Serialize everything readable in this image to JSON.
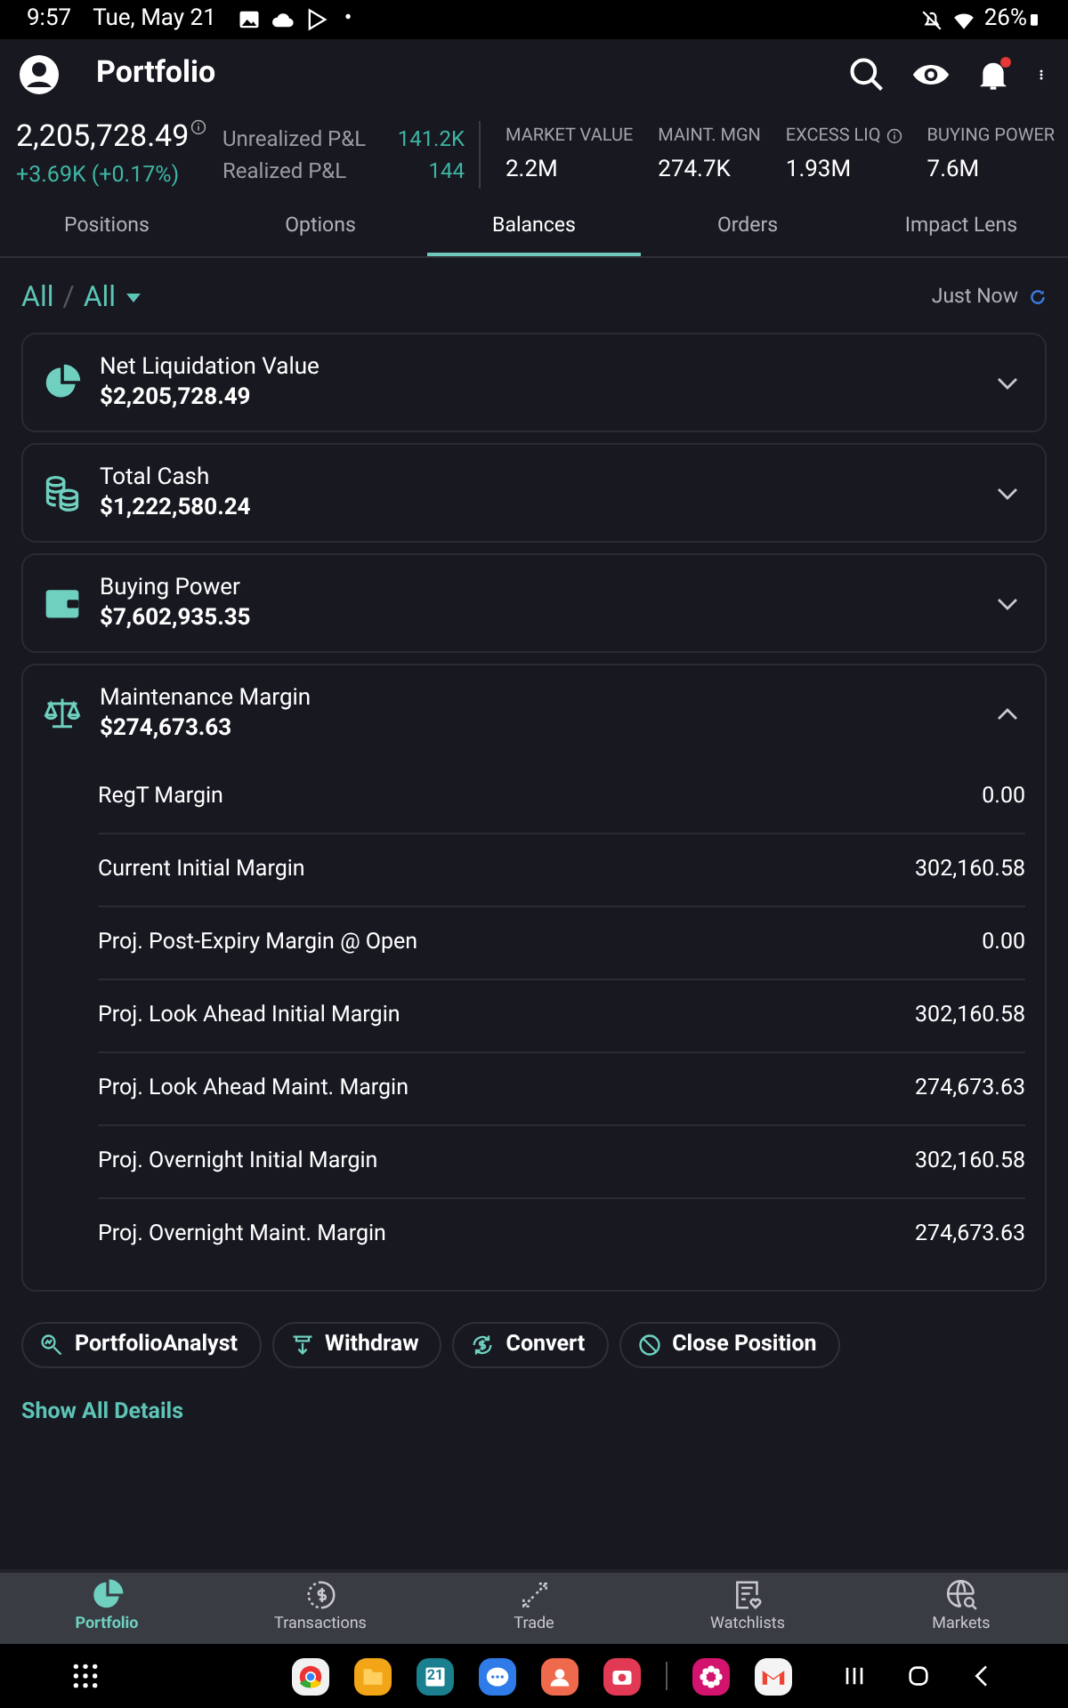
{
  "status_bar": {
    "time": "9:57",
    "date": "Tue, May 21",
    "dot": "•",
    "battery": "26%"
  },
  "header": {
    "title": "Portfolio",
    "notification_unread": true
  },
  "summary": {
    "net_value": "2,205,728.49",
    "change": "+3.69K (+0.17%)",
    "pnl": [
      {
        "label": "Unrealized P&L",
        "value": "141.2K"
      },
      {
        "label": "Realized P&L",
        "value": "144"
      }
    ],
    "metrics": [
      {
        "label": "MARKET VALUE",
        "value": "2.2M",
        "info": false
      },
      {
        "label": "MAINT. MGN",
        "value": "274.7K",
        "info": false
      },
      {
        "label": "EXCESS LIQ",
        "value": "1.93M",
        "info": true
      },
      {
        "label": "BUYING POWER",
        "value": "7.6M",
        "info": false
      }
    ]
  },
  "tabs": [
    {
      "label": "Positions",
      "selected": false
    },
    {
      "label": "Options",
      "selected": false
    },
    {
      "label": "Balances",
      "selected": true
    },
    {
      "label": "Orders",
      "selected": false
    },
    {
      "label": "Impact Lens",
      "selected": false
    }
  ],
  "filter": {
    "account": "All",
    "separator": "/",
    "group": "All",
    "updated": "Just Now"
  },
  "cards": [
    {
      "kind": "pie",
      "title": "Net Liquidation Value",
      "value": "$2,205,728.49",
      "expanded": false
    },
    {
      "kind": "coins",
      "title": "Total Cash",
      "value": "$1,222,580.24",
      "expanded": false
    },
    {
      "kind": "wallet",
      "title": "Buying Power",
      "value": "$7,602,935.35",
      "expanded": false
    },
    {
      "kind": "scale",
      "title": "Maintenance Margin",
      "value": "$274,673.63",
      "expanded": true,
      "rows": [
        {
          "label": "RegT Margin",
          "value": "0.00"
        },
        {
          "label": "Current Initial Margin",
          "value": "302,160.58"
        },
        {
          "label": "Proj. Post-Expiry Margin @ Open",
          "value": "0.00"
        },
        {
          "label": "Proj. Look Ahead Initial Margin",
          "value": "302,160.58"
        },
        {
          "label": "Proj. Look Ahead Maint. Margin",
          "value": "274,673.63"
        },
        {
          "label": "Proj. Overnight Initial Margin",
          "value": "302,160.58"
        },
        {
          "label": "Proj. Overnight Maint. Margin",
          "value": "274,673.63"
        }
      ]
    }
  ],
  "actions": [
    {
      "kind": "analyst",
      "label": "PortfolioAnalyst"
    },
    {
      "kind": "withdraw",
      "label": "Withdraw"
    },
    {
      "kind": "convert",
      "label": "Convert"
    },
    {
      "kind": "close",
      "label": "Close Position"
    }
  ],
  "show_all": "Show All Details",
  "bottom_nav": [
    {
      "kind": "portfolio",
      "label": "Portfolio",
      "selected": true
    },
    {
      "kind": "transactions",
      "label": "Transactions",
      "selected": false
    },
    {
      "kind": "trade",
      "label": "Trade",
      "selected": false
    },
    {
      "kind": "watchlists",
      "label": "Watchlists",
      "selected": false
    },
    {
      "kind": "markets",
      "label": "Markets",
      "selected": false
    }
  ],
  "dock": [
    {
      "kind": "chrome",
      "color": "#f1f1f1"
    },
    {
      "kind": "files",
      "color": "#f2a516"
    },
    {
      "kind": "calendar",
      "color": "#1a7f8e",
      "label": "21"
    },
    {
      "kind": "messages",
      "color": "#2f7be8"
    },
    {
      "kind": "contacts",
      "color": "#ef6a4c"
    },
    {
      "kind": "camera",
      "color": "#e23a55"
    },
    {
      "kind": "flower",
      "color": "#d2146e"
    },
    {
      "kind": "gmail",
      "color": "#f4f4f4"
    }
  ]
}
